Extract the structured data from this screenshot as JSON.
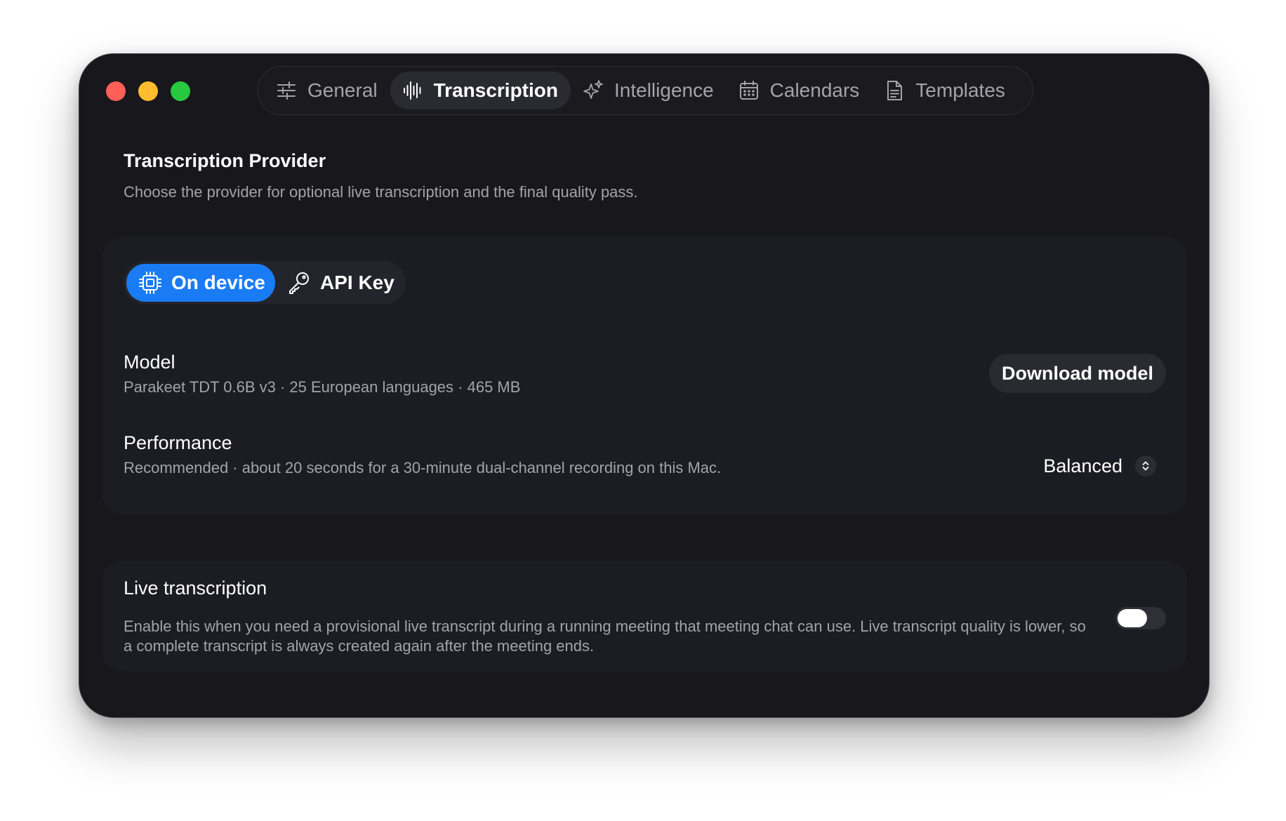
{
  "window": {
    "controls": [
      "close",
      "minimize",
      "zoom"
    ]
  },
  "tabs": [
    {
      "label": "General",
      "icon": "sliders-icon",
      "active": false
    },
    {
      "label": "Transcription",
      "icon": "waveform-icon",
      "active": true
    },
    {
      "label": "Intelligence",
      "icon": "sparkles-icon",
      "active": false
    },
    {
      "label": "Calendars",
      "icon": "calendar-icon",
      "active": false
    },
    {
      "label": "Templates",
      "icon": "document-icon",
      "active": false
    }
  ],
  "provider": {
    "title": "Transcription Provider",
    "description": "Choose the provider for optional live transcription and the final quality pass.",
    "options": [
      {
        "label": "On device",
        "icon": "chip-icon",
        "selected": true
      },
      {
        "label": "API Key",
        "icon": "key-icon",
        "selected": false
      }
    ],
    "model": {
      "title": "Model",
      "description": "Parakeet TDT 0.6B v3 · 25 European languages · 465 MB",
      "button": "Download model"
    },
    "performance": {
      "title": "Performance",
      "description": "Recommended · about 20 seconds for a 30-minute dual-channel recording on this Mac.",
      "value": "Balanced"
    }
  },
  "live": {
    "title": "Live transcription",
    "description": "Enable this when you need a provisional live transcript during a running meeting that meeting chat can use. Live transcript quality is lower, so a complete transcript is always created again after the meeting ends.",
    "enabled": false
  },
  "colors": {
    "accent": "#1a7cf5",
    "window_bg": "#17171c",
    "card_bg": "#1c1c23",
    "close": "#fe5f57",
    "minimize": "#febc2e",
    "zoom": "#28c840"
  }
}
